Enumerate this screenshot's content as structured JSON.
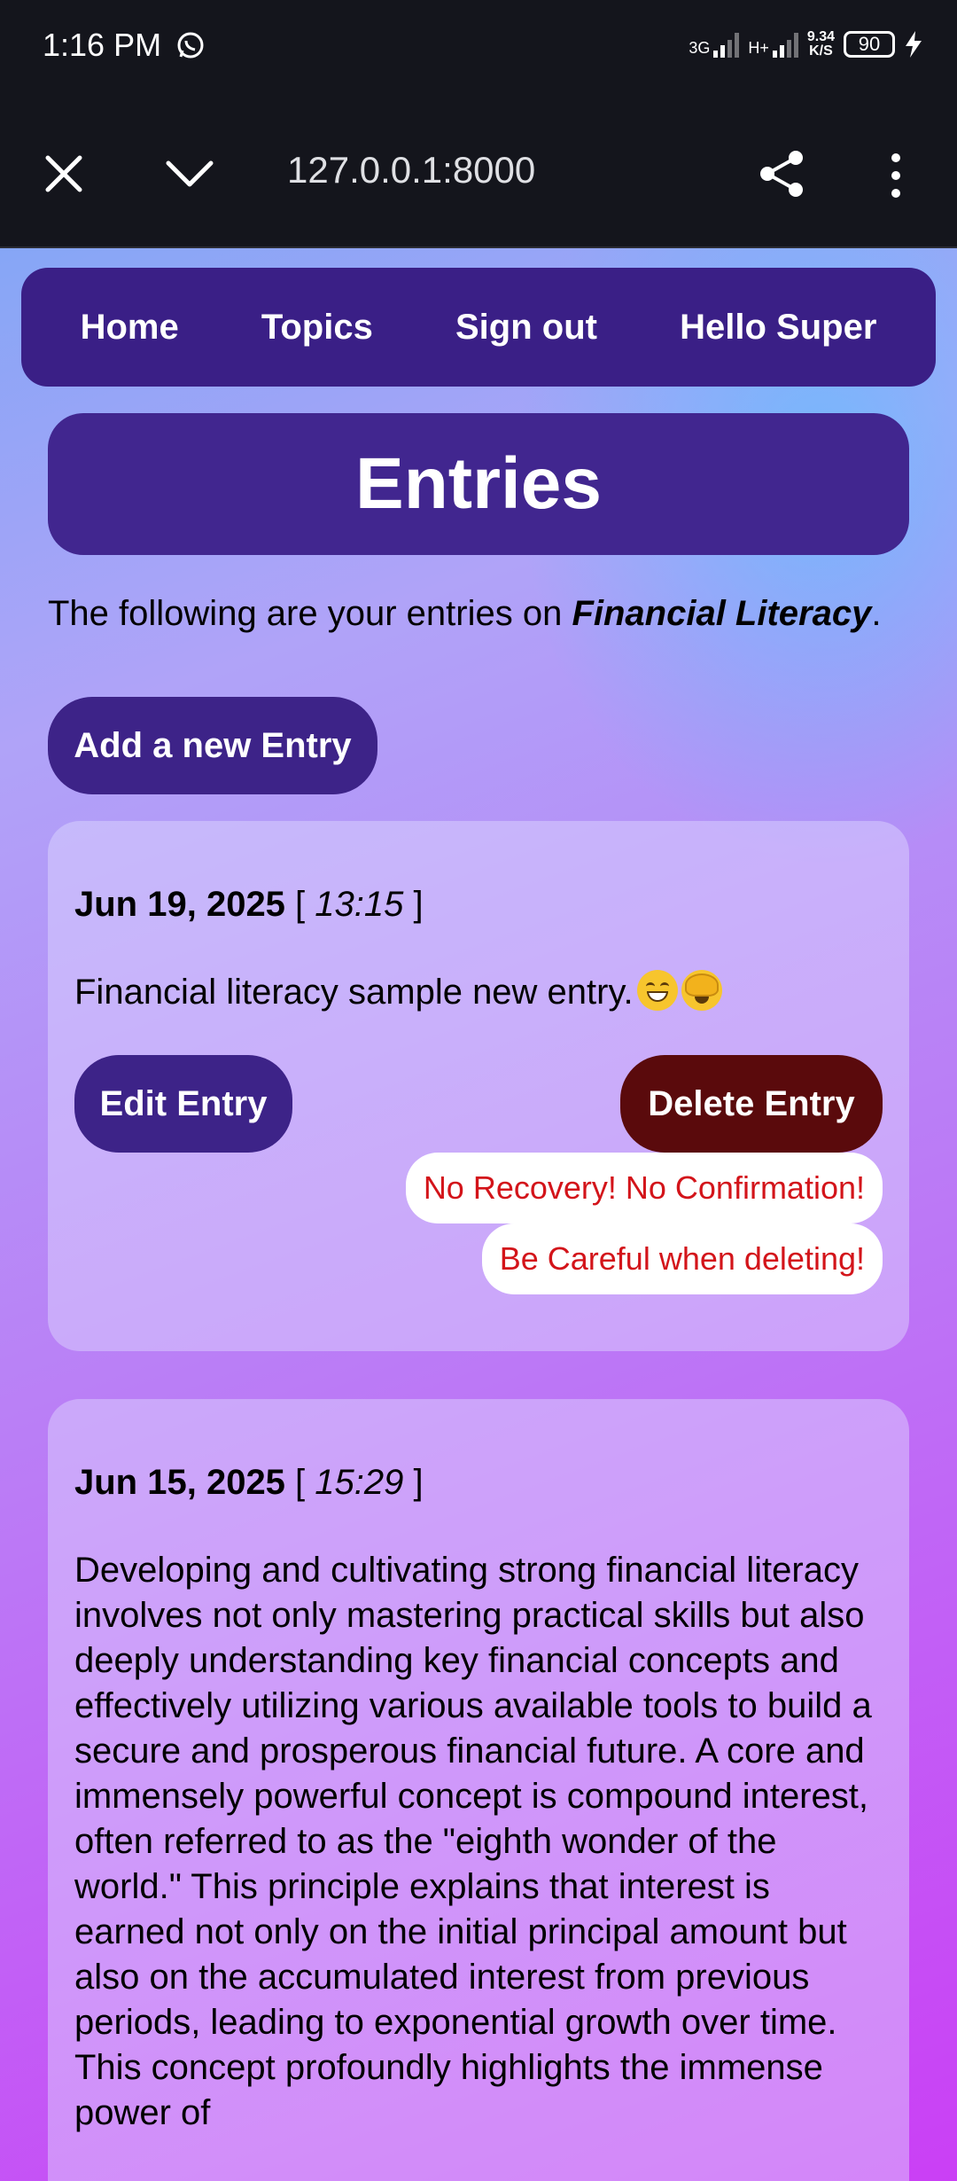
{
  "status_bar": {
    "time": "1:16 PM",
    "net1": "3G",
    "net2": "H+",
    "speed_value": "9.34",
    "speed_unit": "K/S",
    "battery": "90"
  },
  "browser": {
    "url": "127.0.0.1:8000"
  },
  "nav": {
    "items": [
      "Home",
      "Topics",
      "Sign out",
      "Hello Super"
    ]
  },
  "page": {
    "title": "Entries",
    "intro_prefix": "The following are your entries on ",
    "topic": "Financial Literacy",
    "intro_suffix": ".",
    "add_button": "Add a new Entry"
  },
  "entries": [
    {
      "date": "Jun 19, 2025",
      "time": "13:15",
      "text": "Financial literacy sample new entry.",
      "edit_label": "Edit Entry",
      "delete_label": "Delete Entry",
      "warning_1": "No Recovery! No Confirmation!",
      "warning_2": "Be Careful when deleting!"
    },
    {
      "date": "Jun 15, 2025",
      "time": "15:29",
      "text": "Developing and cultivating strong financial literacy involves not only mastering practical skills but also deeply understanding key financial concepts and effectively utilizing various available tools to build a secure and prosperous financial future. A core and immensely powerful concept is compound interest, often referred to as the \"eighth wonder of the world.\" This principle explains that interest is earned not only on the initial principal amount but also on the accumulated interest from previous periods, leading to exponential growth over time. This concept profoundly highlights the immense power of"
    }
  ]
}
